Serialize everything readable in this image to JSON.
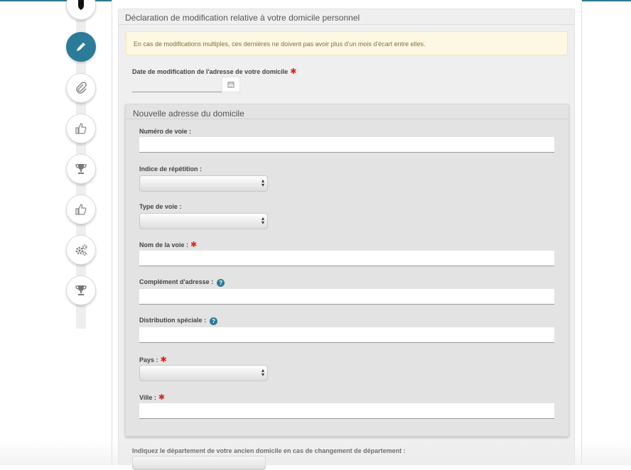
{
  "section": {
    "title": "Déclaration de modification relative à votre domicile personnel",
    "notice": "En cas de modifications multiples, ces dernières ne doivent pas avoir plus d'un mois d'écart entre elles.",
    "date_label": "Date de modification de l'adresse de votre domicile",
    "date_value": ""
  },
  "required_mark": "✱",
  "help_mark": "?",
  "address": {
    "title": "Nouvelle adresse du domicile",
    "numero_label": "Numéro de voie :",
    "indice_label": "Indice de répétition :",
    "type_label": "Type de voie :",
    "nom_label": "Nom de la voie :",
    "complement_label": "Complément d'adresse :",
    "distribution_label": "Distribution spéciale :",
    "pays_label": "Pays :",
    "ville_label": "Ville :"
  },
  "ancien": {
    "label": "Indiquez le département de votre ancien domicile en cas de changement de département :"
  },
  "steps": [
    {
      "icon": "shield-icon",
      "state": "done"
    },
    {
      "icon": "pencil-icon",
      "state": "active"
    },
    {
      "icon": "paperclip-icon",
      "state": "pending"
    },
    {
      "icon": "thumbs-up-icon",
      "state": "pending"
    },
    {
      "icon": "trophy-icon",
      "state": "pending"
    },
    {
      "icon": "thumbs-up-icon",
      "state": "pending"
    },
    {
      "icon": "gears-icon",
      "state": "pending"
    },
    {
      "icon": "trophy-icon",
      "state": "pending"
    }
  ],
  "colors": {
    "accent": "#2b7c99",
    "required": "#d9261c",
    "notice_bg": "#fcf8e3",
    "notice_text": "#8a6d3b"
  }
}
